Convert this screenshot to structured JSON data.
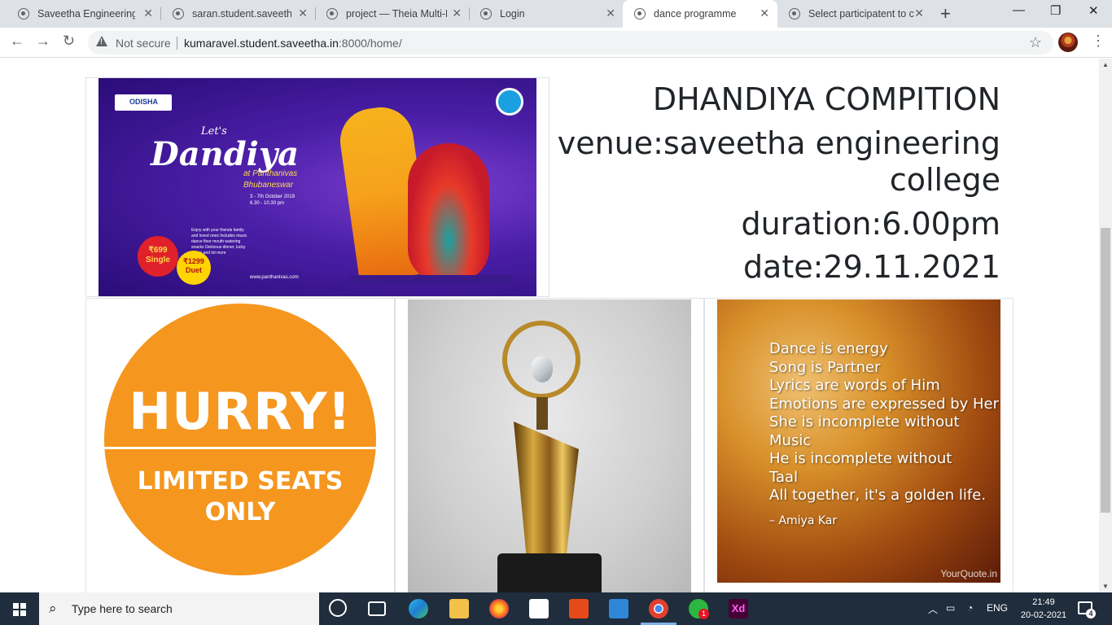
{
  "browser": {
    "tabs": [
      {
        "label": "Saveetha Engineering C"
      },
      {
        "label": "saran.student.saveetha."
      },
      {
        "label": "project — Theia Multi-L"
      },
      {
        "label": "Login"
      },
      {
        "label": "dance programme"
      },
      {
        "label": "Select participatent to c"
      }
    ],
    "active_tab_index": 4,
    "security_label": "Not secure",
    "url_host": "kumaravel.student.saveetha.in",
    "url_rest": ":8000/home/"
  },
  "page": {
    "event_title": "DHANDIYA COMPITION",
    "venue": "venue:saveetha engineering college",
    "duration": "duration:6.00pm",
    "date": "date:29.11.2021",
    "poster": {
      "brand": "ODISHA",
      "lets": "Let's",
      "dandiya": "Dandiya",
      "at": "at Panthanivas",
      "city": "Bhubaneswar",
      "dates_line1": "3 - 7th October 2019",
      "dates_line2": "6.30 - 10.30 pm",
      "price_single": "₹699 Single",
      "price_duet": "₹1299 Duet",
      "bullets": "Enjoy with your friends family and loved ones Includes music dance floor mouth watering snacks Delicious dinner, lucky draws and lot more",
      "site": "www.panthanivas.com"
    },
    "hurry": {
      "headline": "HURRY!",
      "sub1": "LIMITED SEATS",
      "sub2": "ONLY"
    },
    "quote": {
      "lines": [
        "Dance is energy",
        "Song is Partner",
        "Lyrics are words of Him",
        "Emotions are expressed by Her",
        "She is incomplete without",
        "Music",
        "He is incomplete without",
        "Taal",
        "All together, it's a golden life."
      ],
      "author": "– Amiya Kar",
      "brand": "YourQuote.in"
    }
  },
  "taskbar": {
    "search_placeholder": "Type here to search",
    "language": "ENG",
    "time": "21:49",
    "date": "20-02-2021",
    "notification_count": "4",
    "whatsapp_badge": "1"
  },
  "colors": {
    "hurry_orange": "#f5961f",
    "poster_purple": "#4a1ea6",
    "taskbar": "#1f2d3c"
  }
}
